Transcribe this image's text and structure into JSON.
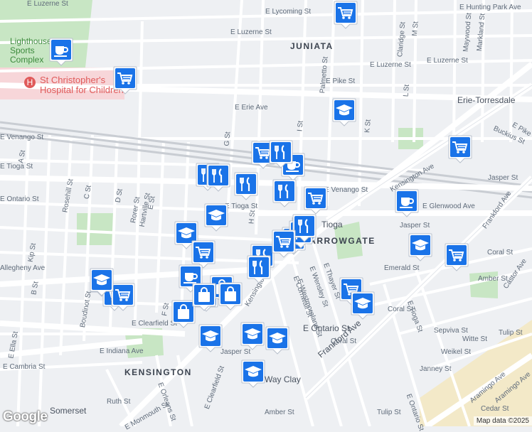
{
  "map": {
    "attribution": "Map data ©2025",
    "logo": "Google",
    "colors": {
      "background": "#eef0f3",
      "road": "#ffffff",
      "major_road": "#fbfbfb",
      "rail": "#c9cdd3",
      "park": "#c8e6c4",
      "hospital_pink": "#f7d6d9",
      "industrial": "#f3e9c8",
      "pin": "#1a73e8"
    },
    "neighborhood_labels": [
      "JUNIATA",
      "HARROWGATE",
      "KENSINGTON"
    ],
    "poi_labels": [
      "St Christopher's Hospital for Children",
      "Lighthouse Sports Complex",
      "Tioga",
      "Somerset",
      "Erie-Torresdale",
      "Way Clay"
    ],
    "street_labels": [
      "E Luzerne St",
      "E Lycoming St",
      "E Hunting Park Ave",
      "E Luzerne St",
      "E Pike St",
      "E Erie Ave",
      "E Venango St",
      "E Tioga St",
      "E Tioga St",
      "E Venango St",
      "Kensington Ave",
      "E Glenwood Ave",
      "Frankford Ave",
      "E Ontario St",
      "Allegheny Ave",
      "E Indiana Ave",
      "E Cambria St",
      "E Clearfield St",
      "E Westmoreland St",
      "E Wensley St",
      "E Cornwall St",
      "E Thayer St",
      "Coral St",
      "Amber St",
      "Castor Ave",
      "Jasper St",
      "Emerald St",
      "Tulip St",
      "Aramingo Ave",
      "Janney St",
      "Weikel St",
      "Sepviva St",
      "Witte St",
      "Cedar St",
      "E Orleans St",
      "Ruth St",
      "E Monmouth St",
      "Kip St",
      "Rosehill St",
      "C St",
      "D St",
      "Rorer St",
      "Hartville St",
      "E St",
      "G St",
      "H St",
      "I St",
      "K St",
      "L St",
      "M St",
      "Claridge St",
      "Palmetto St",
      "Maywood St",
      "Markland St",
      "Buckius St",
      "Boudinot St",
      "A St",
      "B St",
      "E Ella St",
      "F St",
      "Tioga"
    ],
    "markers": [
      {
        "type": "coffee"
      },
      {
        "type": "shopping"
      },
      {
        "type": "shopping"
      },
      {
        "type": "school"
      },
      {
        "type": "shopping"
      },
      {
        "type": "restaurant"
      },
      {
        "type": "shopping"
      },
      {
        "type": "coffee"
      },
      {
        "type": "restaurant"
      },
      {
        "type": "restaurant"
      },
      {
        "type": "restaurant"
      },
      {
        "type": "restaurant"
      },
      {
        "type": "restaurant"
      },
      {
        "type": "shopping"
      },
      {
        "type": "school"
      },
      {
        "type": "school"
      },
      {
        "type": "coffee"
      },
      {
        "type": "shopping"
      },
      {
        "type": "shopping"
      },
      {
        "type": "restaurant"
      },
      {
        "type": "restaurant"
      },
      {
        "type": "restaurant"
      },
      {
        "type": "restaurant"
      },
      {
        "type": "shopping"
      },
      {
        "type": "shopping"
      },
      {
        "type": "school"
      },
      {
        "type": "shopping"
      },
      {
        "type": "coffee"
      },
      {
        "type": "school"
      },
      {
        "type": "shopping"
      },
      {
        "type": "shopping"
      },
      {
        "type": "bag"
      },
      {
        "type": "bag"
      },
      {
        "type": "bag"
      },
      {
        "type": "bag"
      },
      {
        "type": "school"
      },
      {
        "type": "school"
      },
      {
        "type": "school"
      },
      {
        "type": "school"
      },
      {
        "type": "school"
      },
      {
        "type": "shopping"
      },
      {
        "type": "school"
      }
    ]
  }
}
